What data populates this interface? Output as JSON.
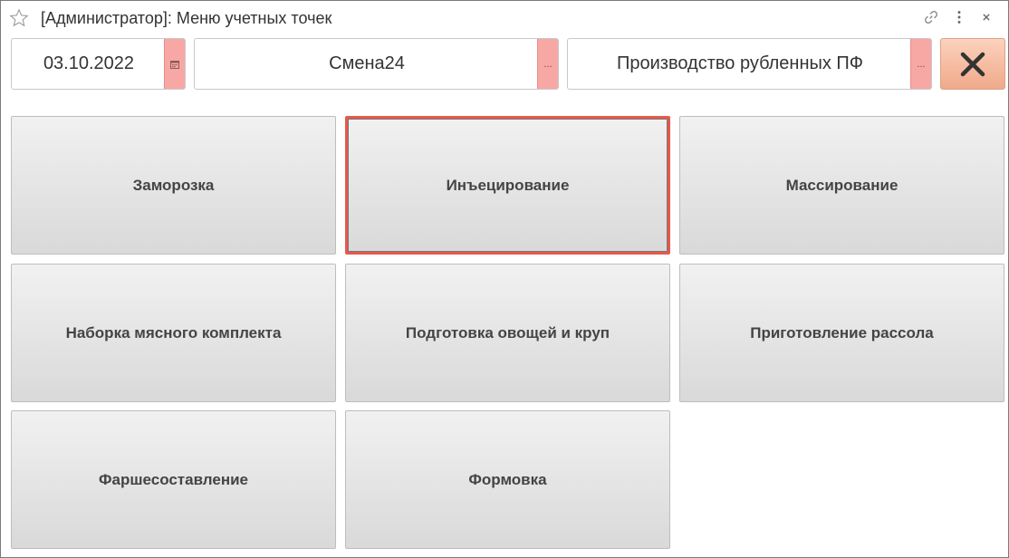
{
  "window": {
    "title": "[Администратор]: Меню учетных точек"
  },
  "header": {
    "date_value": "03.10.2022",
    "date_button": "calendar-icon",
    "shift_value": "Смена24",
    "shift_button": "...",
    "production_value": "Производство рубленных ПФ",
    "production_button": "..."
  },
  "tiles": [
    {
      "label": "Заморозка"
    },
    {
      "label": "Инъецирование",
      "selected": true
    },
    {
      "label": "Массирование"
    },
    {
      "label": "Наборка мясного комплекта"
    },
    {
      "label": "Подготовка овощей и круп"
    },
    {
      "label": "Приготовление рассола"
    },
    {
      "label": "Фаршесоставление"
    },
    {
      "label": "Формовка"
    }
  ],
  "colors": {
    "accent_red": "#e35a4d",
    "field_button": "#f7a8a4",
    "close_button": "#f0a98a"
  }
}
